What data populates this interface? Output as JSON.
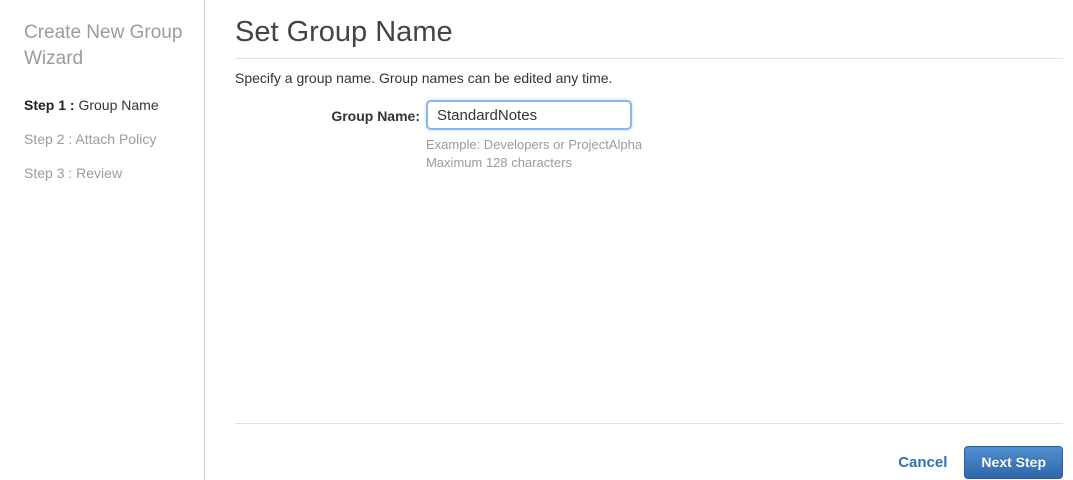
{
  "sidebar": {
    "title": "Create New Group Wizard",
    "steps": [
      {
        "prefix": "Step 1 :",
        "label": "Group Name"
      },
      {
        "prefix": "Step 2 :",
        "label": "Attach Policy"
      },
      {
        "prefix": "Step 3 :",
        "label": "Review"
      }
    ]
  },
  "main": {
    "title": "Set Group Name",
    "description": "Specify a group name. Group names can be edited any time.",
    "form": {
      "label": "Group Name:",
      "value": "StandardNotes",
      "hint_example": "Example: Developers or ProjectAlpha",
      "hint_max": "Maximum 128 characters"
    },
    "footer": {
      "cancel_label": "Cancel",
      "next_label": "Next Step"
    }
  },
  "colors": {
    "link_blue": "#2d72b8",
    "button_gradient_top": "#4f90d1",
    "button_gradient_bottom": "#3166ab",
    "input_focus_border": "#8ab6e9",
    "inactive_text": "#9b9b9b",
    "divider": "#e1e1e1"
  }
}
